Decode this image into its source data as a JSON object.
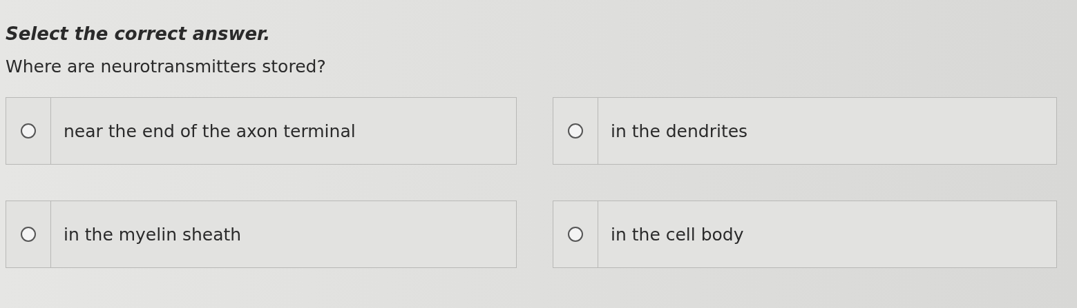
{
  "instruction": "Select the correct answer.",
  "question": "Where are neurotransmitters stored?",
  "options": [
    {
      "label": "near the end of the axon terminal",
      "selected": false
    },
    {
      "label": "in the dendrites",
      "selected": false
    },
    {
      "label": "in the myelin sheath",
      "selected": false
    },
    {
      "label": "in the cell body",
      "selected": false
    }
  ]
}
